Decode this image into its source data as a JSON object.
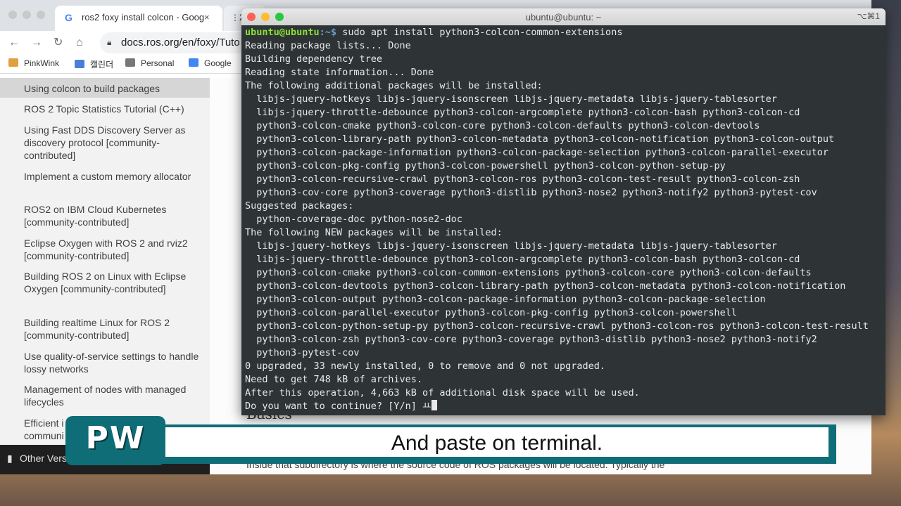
{
  "browser": {
    "tabs": [
      {
        "label": "ros2 foxy install colcon - Goog",
        "close": "×"
      },
      {
        "label": "2",
        "icon": "grid-icon"
      }
    ],
    "url": "docs.ros.org/en/foxy/Tuto",
    "bookmarks": [
      "PinkWink",
      "캘린더",
      "Personal",
      "Google"
    ]
  },
  "sidebar": {
    "items": [
      "Using colcon to build packages",
      "ROS 2 Topic Statistics Tutorial (C++)",
      "Using Fast DDS Discovery Server as discovery protocol [community-contributed]",
      "Implement a custom memory allocator",
      "ROS2 on IBM Cloud Kubernetes [community-contributed]",
      "Eclipse Oxygen with ROS 2 and rviz2 [community-contributed]",
      "Building ROS 2 on Linux with Eclipse Oxygen [community-contributed]",
      "Building realtime Linux for ROS 2 [community-contributed]",
      "Use quality-of-service settings to handle lossy networks",
      "Management of nodes with managed lifecycles",
      "Efficient i",
      "communi"
    ],
    "other_versions": "Other Vers"
  },
  "content": {
    "heading": "Basics",
    "paragraph": "Inside that subdirectory is where the source code of ROS packages will be located. Typically the"
  },
  "terminal": {
    "title": "ubuntu@ubuntu: ~",
    "shortcut": "⌥⌘1",
    "prompt_user": "ubuntu@ubuntu",
    "prompt_path": ":~$ ",
    "command": "sudo apt install python3-colcon-common-extensions",
    "output": [
      "Reading package lists... Done",
      "Building dependency tree",
      "Reading state information... Done",
      "The following additional packages will be installed:",
      "  libjs-jquery-hotkeys libjs-jquery-isonscreen libjs-jquery-metadata libjs-jquery-tablesorter",
      "  libjs-jquery-throttle-debounce python3-colcon-argcomplete python3-colcon-bash python3-colcon-cd",
      "  python3-colcon-cmake python3-colcon-core python3-colcon-defaults python3-colcon-devtools",
      "  python3-colcon-library-path python3-colcon-metadata python3-colcon-notification python3-colcon-output",
      "  python3-colcon-package-information python3-colcon-package-selection python3-colcon-parallel-executor",
      "  python3-colcon-pkg-config python3-colcon-powershell python3-colcon-python-setup-py",
      "  python3-colcon-recursive-crawl python3-colcon-ros python3-colcon-test-result python3-colcon-zsh",
      "  python3-cov-core python3-coverage python3-distlib python3-nose2 python3-notify2 python3-pytest-cov",
      "Suggested packages:",
      "  python-coverage-doc python-nose2-doc",
      "The following NEW packages will be installed:",
      "  libjs-jquery-hotkeys libjs-jquery-isonscreen libjs-jquery-metadata libjs-jquery-tablesorter",
      "  libjs-jquery-throttle-debounce python3-colcon-argcomplete python3-colcon-bash python3-colcon-cd",
      "  python3-colcon-cmake python3-colcon-common-extensions python3-colcon-core python3-colcon-defaults",
      "  python3-colcon-devtools python3-colcon-library-path python3-colcon-metadata python3-colcon-notification",
      "  python3-colcon-output python3-colcon-package-information python3-colcon-package-selection",
      "  python3-colcon-parallel-executor python3-colcon-pkg-config python3-colcon-powershell",
      "  python3-colcon-python-setup-py python3-colcon-recursive-crawl python3-colcon-ros python3-colcon-test-result",
      "  python3-colcon-zsh python3-cov-core python3-coverage python3-distlib python3-nose2 python3-notify2",
      "  python3-pytest-cov",
      "0 upgraded, 33 newly installed, 0 to remove and 0 not upgraded.",
      "Need to get 748 kB of archives.",
      "After this operation, 4,663 kB of additional disk space will be used."
    ],
    "question": "Do you want to continue? [Y/n] ",
    "typed": "ㅛ"
  },
  "caption": {
    "logo": "PW",
    "text": "And paste on terminal."
  },
  "colors": {
    "terminal_bg": "#2e3436",
    "prompt_user": "#8ae234",
    "prompt_path": "#729fcf",
    "caption_accent": "#0f6d78"
  }
}
